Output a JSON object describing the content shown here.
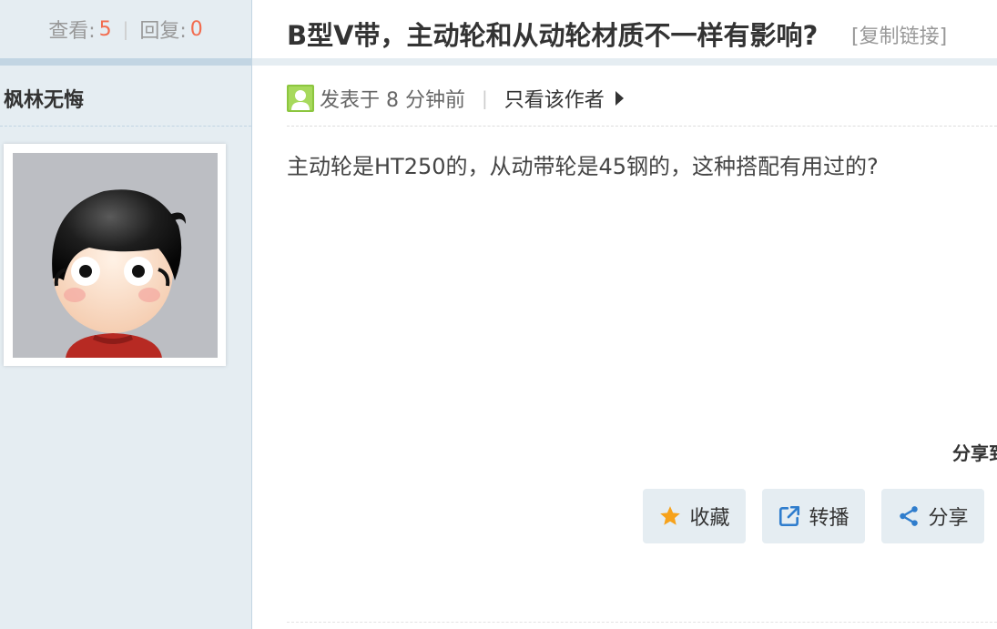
{
  "stats": {
    "views_label": "查看:",
    "views_count": "5",
    "replies_label": "回复:",
    "replies_count": "0"
  },
  "author": {
    "name": "枫林无悔",
    "avatar_icon": "cartoon-boy-avatar"
  },
  "thread": {
    "title": "B型V带，主动轮和从动轮材质不一样有影响?",
    "copy_link": "[复制链接]"
  },
  "post": {
    "posted_time": "发表于 8 分钟前",
    "only_author": "只看该作者",
    "body": "主动轮是HT250的，从动带轮是45钢的，这种搭配有用过的?"
  },
  "actions": {
    "share_to": "分享到",
    "favorite_label": "收藏",
    "favorite_icon": "star-icon",
    "repost_label": "转播",
    "repost_icon": "external-link-icon",
    "share_label": "分享",
    "share_icon": "share-icon"
  },
  "colors": {
    "accent_orange": "#f26c4f",
    "sidebar_bg": "#e5edf2",
    "star_color": "#f7a21b",
    "icon_blue": "#2f7dcd"
  }
}
